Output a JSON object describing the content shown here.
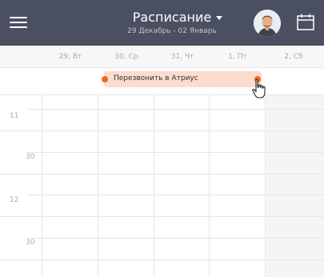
{
  "header": {
    "title": "Расписание",
    "subtitle": "29 Декабрь - 02 Январь",
    "bg_color": "#4a5062"
  },
  "icons": {
    "menu": "hamburger-menu-icon",
    "dropdown": "chevron-down-icon",
    "avatar": "user-avatar",
    "calendar": "calendar-icon",
    "cursor": "hand-pointer-icon"
  },
  "days": [
    "29, Вт",
    "30, Ср",
    "31, Чт",
    "1, Пт",
    "2, Сб"
  ],
  "event": {
    "label": "Перезвонить в Атриус",
    "bg_color": "#fbdccd",
    "dot_color": "#f06a13"
  },
  "times": [
    {
      "label": "11"
    },
    {
      "label": "30"
    },
    {
      "label": "12"
    },
    {
      "label": "30"
    }
  ]
}
